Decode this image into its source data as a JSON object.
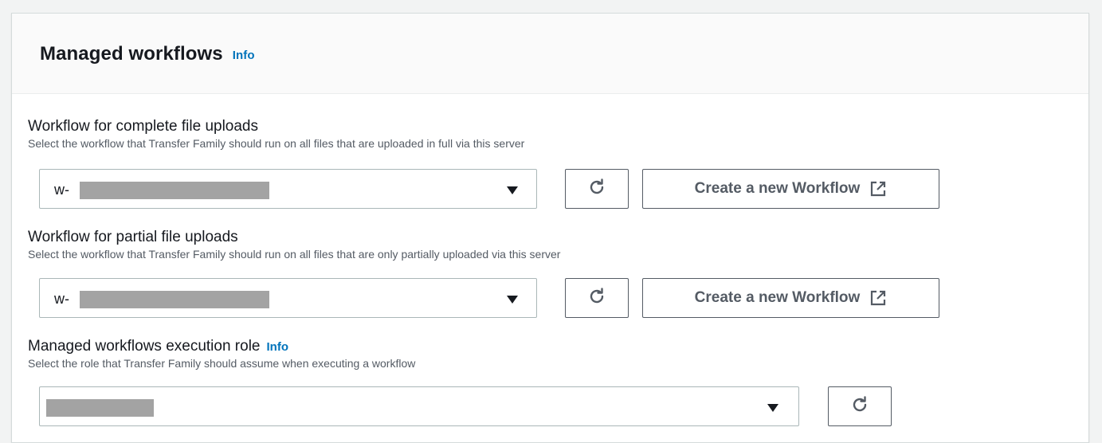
{
  "panel": {
    "title": "Managed workflows",
    "info": "Info"
  },
  "complete_uploads": {
    "label": "Workflow for complete file uploads",
    "description": "Select the workflow that Transfer Family should run on all files that are uploaded in full via this server",
    "selected_value": "w-",
    "create_button": "Create a new Workflow"
  },
  "partial_uploads": {
    "label": "Workflow for partial file uploads",
    "description": "Select the workflow that Transfer Family should run on all files that are only partially uploaded via this server",
    "selected_value": "w-",
    "create_button": "Create a new Workflow"
  },
  "execution_role": {
    "label": "Managed workflows execution role",
    "info": "Info",
    "description": "Select the role that  Transfer Family should assume when executing a workflow",
    "selected_value": ""
  },
  "icons": {
    "refresh": "refresh-icon",
    "external": "external-link-icon",
    "caret": "caret-down-icon"
  },
  "colors": {
    "link": "#0073bb",
    "border": "#aab7b8",
    "button_border": "#545b64",
    "redaction": "#a3a3a3"
  }
}
